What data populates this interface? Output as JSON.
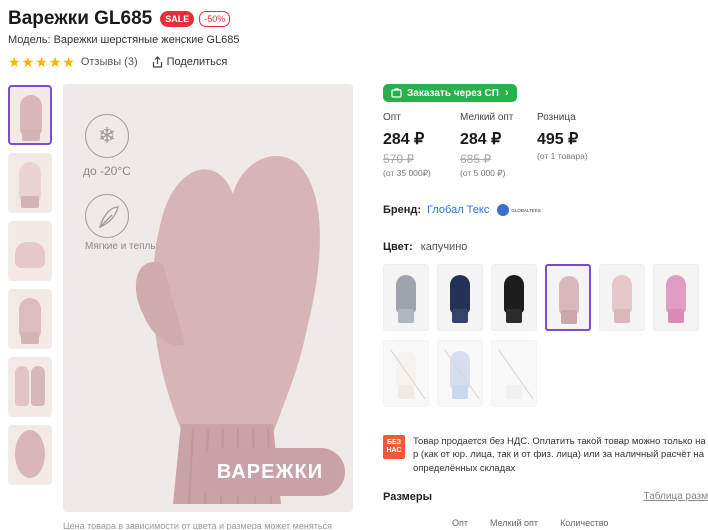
{
  "product": {
    "title": "Варежки GL685",
    "sale_badge": "SALE",
    "discount_badge": "-50%",
    "model": "Модель: Варежки шерстяные женские GL685"
  },
  "rating": {
    "stars": 5,
    "reviews": "Отзывы (3)",
    "share": "Поделиться"
  },
  "image": {
    "temp": "до -20°C",
    "soft": "Мягкие и теплые",
    "brand_text": "ВАРЕЖКИ",
    "caption": "Цена товара в зависимости от цвета и размера может меняться"
  },
  "order": {
    "label": "Заказать через СП"
  },
  "prices": [
    {
      "label": "Опт",
      "now": "284 ₽",
      "old": "570 ₽",
      "note": "(от 35 000₽)"
    },
    {
      "label": "Мелкий опт",
      "now": "284 ₽",
      "old": "685 ₽",
      "note": "(от 5 000 ₽)"
    },
    {
      "label": "Розница",
      "now": "495 ₽",
      "old": "",
      "note": "(от 1 товара)"
    }
  ],
  "brand": {
    "label": "Бренд:",
    "name": "Глобал Текс",
    "logo_text": "GLOBALTEKS"
  },
  "color": {
    "label": "Цвет:",
    "value": "капучино",
    "swatches": [
      {
        "color": "#9ea3ad",
        "cuff": "#b2b6be",
        "active": false,
        "disabled": false
      },
      {
        "color": "#263156",
        "cuff": "#36426a",
        "active": false,
        "disabled": false
      },
      {
        "color": "#1c1c1c",
        "cuff": "#2c2c2c",
        "active": false,
        "disabled": false
      },
      {
        "color": "#d9b8bb",
        "cuff": "#c9a6a9",
        "active": true,
        "disabled": false
      },
      {
        "color": "#e6c7cc",
        "cuff": "#dbb6bb",
        "active": false,
        "disabled": false
      },
      {
        "color": "#e39cc4",
        "cuff": "#d98ab6",
        "active": false,
        "disabled": false
      },
      {
        "color": "#f1ece4",
        "cuff": "#e6ddd1",
        "active": false,
        "disabled": true
      },
      {
        "color": "#b8c9e6",
        "cuff": "#a8bde0",
        "active": false,
        "disabled": true
      },
      {
        "color": "#f4f4f2",
        "cuff": "#e9e9e6",
        "active": false,
        "disabled": true
      }
    ]
  },
  "nds": {
    "badge_top": "БЕЗ",
    "badge_bottom": "НАС",
    "text": "Товар продается без НДС. Оплатить такой товар можно только на р (как от юр. лица, так и от физ. лица) или за наличный расчёт на определённых складах"
  },
  "sizes": {
    "label": "Размеры",
    "table_link": "Таблица разм",
    "columns": [
      "Опт",
      "Мелкий опт",
      "Количество"
    ]
  },
  "colors": {
    "accent": "#28b04a",
    "sale": "#e5303c",
    "link": "#2f6fe0",
    "active_border": "#7a4bd6"
  }
}
